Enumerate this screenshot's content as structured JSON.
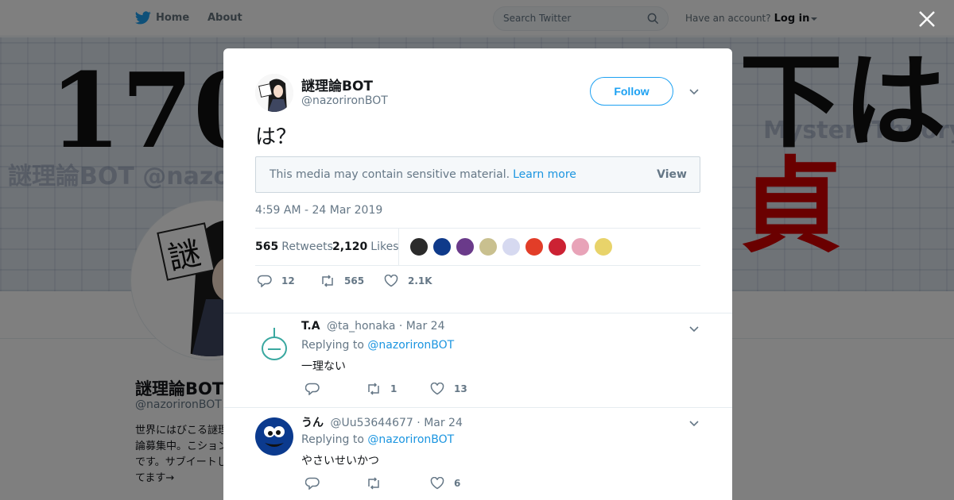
{
  "topbar": {
    "home_label": "Home",
    "about_label": "About",
    "search_placeholder": "Search Twitter",
    "account_prompt": "Have an account?",
    "login_label": "Log in"
  },
  "banner": {
    "text_left": "170",
    "text_right": "下は",
    "text_red": "貞",
    "ghost_1": "謎理論BOT @nazoriron",
    "ghost_2": "MysteryTheory @nazorironBOT"
  },
  "profile": {
    "name": "謎理論BOT",
    "handle": "@nazorironBOT",
    "bio": "世界にはびこる謎理論募集中。こションです。サブイートしてます→"
  },
  "tweet": {
    "author_name": "謎理論BOT",
    "author_handle": "@nazorironBOT",
    "follow_label": "Follow",
    "text": "は？",
    "sensitive_text": "This media may contain sensitive material.",
    "learn_more": "Learn more",
    "view_label": "View",
    "timestamp": "4:59 AM - 24 Mar 2019",
    "retweets_count": "565",
    "retweets_label": "Retweets",
    "likes_count": "2,120",
    "likes_label": "Likes",
    "action_reply_count": "12",
    "action_retweet_count": "565",
    "action_like_count": "2.1K",
    "liker_colors": [
      "#2b2b2b",
      "#0f3a8a",
      "#6a3a8a",
      "#c9c08f",
      "#d6d9f0",
      "#e23d28",
      "#cc2233",
      "#e8a3b8",
      "#e8d36a"
    ]
  },
  "replies": [
    {
      "name": "T.A",
      "handle": "@ta_honaka",
      "date": "· Mar 24",
      "replying_prefix": "Replying to",
      "replying_to": "@nazorironBOT",
      "text": "一理ない",
      "reply_count": "",
      "retweet_count": "1",
      "like_count": "13"
    },
    {
      "name": "うん",
      "handle": "@Uu53644677",
      "date": "· Mar 24",
      "replying_prefix": "Replying to",
      "replying_to": "@nazorironBOT",
      "text": "やさいせいかつ",
      "reply_count": "",
      "retweet_count": "",
      "like_count": "6"
    }
  ],
  "colors": {
    "twitter_blue": "#1da1f2",
    "link_blue": "#1b95e0",
    "gray_text": "#657786"
  }
}
